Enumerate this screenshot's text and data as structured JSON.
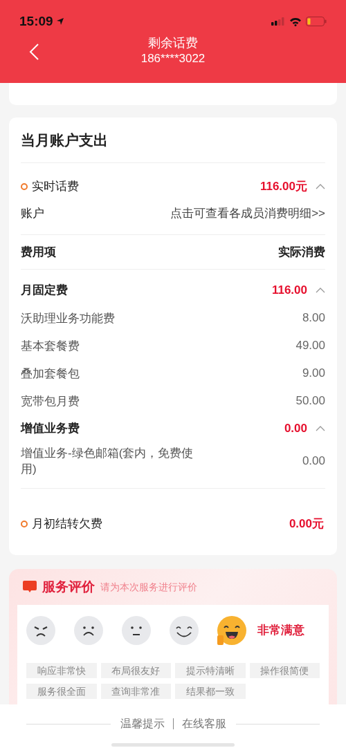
{
  "status_bar": {
    "time": "15:09"
  },
  "header": {
    "title": "剩余话费",
    "subtitle": "186****3022"
  },
  "expense_card": {
    "title": "当月账户支出",
    "realtime": {
      "label": "实时话费",
      "amount": "116.00元",
      "expanded": true
    },
    "account": {
      "label": "账户",
      "link": "点击可查看各成员消费明细>>"
    },
    "columns": [
      "费用项",
      "实际消费"
    ],
    "groups": [
      {
        "name": "月固定费",
        "total": "116.00",
        "expanded": true,
        "items": [
          {
            "name": "沃助理业务功能费",
            "value": "8.00"
          },
          {
            "name": "基本套餐费",
            "value": "49.00"
          },
          {
            "name": "叠加套餐包",
            "value": "9.00"
          },
          {
            "name": "宽带包月费",
            "value": "50.00"
          }
        ]
      },
      {
        "name": "增值业务费",
        "total": "0.00",
        "expanded": true,
        "items": [
          {
            "name": "增值业务-绿色邮箱(套内，免费使用)",
            "value": "0.00"
          }
        ]
      }
    ],
    "carryover": {
      "label": "月初结转欠费",
      "amount": "0.00元"
    }
  },
  "rating": {
    "title": "服务评价",
    "hint": "请为本次服务进行评价",
    "faces": [
      {
        "kind": "angry",
        "selected": false
      },
      {
        "kind": "sad",
        "selected": false
      },
      {
        "kind": "neutral",
        "selected": false
      },
      {
        "kind": "smile",
        "selected": false
      },
      {
        "kind": "laugh",
        "selected": true
      }
    ],
    "selected_label": "非常满意",
    "tags": [
      "响应非常快",
      "布局很友好",
      "提示特清晰",
      "操作很简便",
      "服务很全面",
      "查询非常准",
      "结果都一致"
    ]
  },
  "footer": {
    "links": [
      "温馨提示",
      "在线客服"
    ]
  }
}
